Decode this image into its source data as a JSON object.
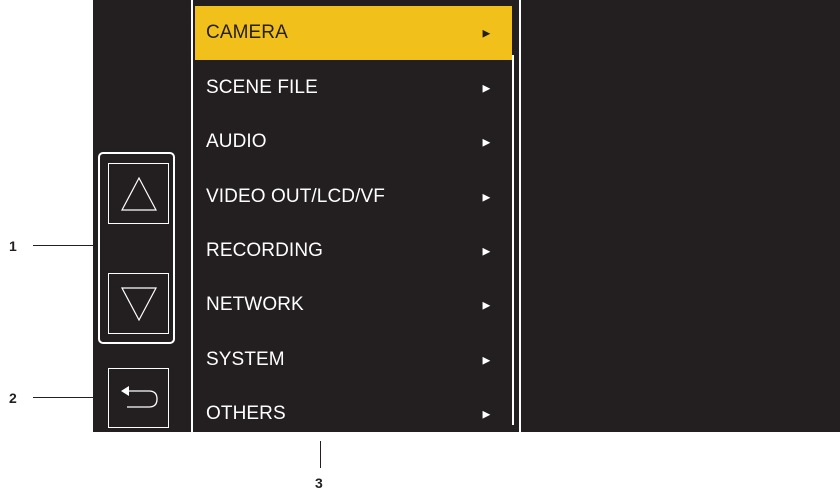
{
  "menu": {
    "items": [
      {
        "label": "CAMERA",
        "arrow": "►",
        "selected": true
      },
      {
        "label": "SCENE FILE",
        "arrow": "►"
      },
      {
        "label": "AUDIO",
        "arrow": "►"
      },
      {
        "label": "VIDEO OUT/LCD/VF",
        "arrow": "►"
      },
      {
        "label": "RECORDING",
        "arrow": "►"
      },
      {
        "label": "NETWORK",
        "arrow": "►"
      },
      {
        "label": "SYSTEM",
        "arrow": "►"
      },
      {
        "label": "OTHERS",
        "arrow": "►"
      }
    ]
  },
  "controls": {
    "scroll_up_icon": "triangle-up-outline",
    "scroll_down_icon": "triangle-down-outline",
    "back_icon": "return-arrow"
  },
  "callouts": {
    "c1": "1",
    "c2": "2",
    "c3": "3"
  },
  "colors": {
    "screen_bg": "#231f20",
    "selected_bg": "#f2c01a",
    "text": "#ffffff"
  }
}
